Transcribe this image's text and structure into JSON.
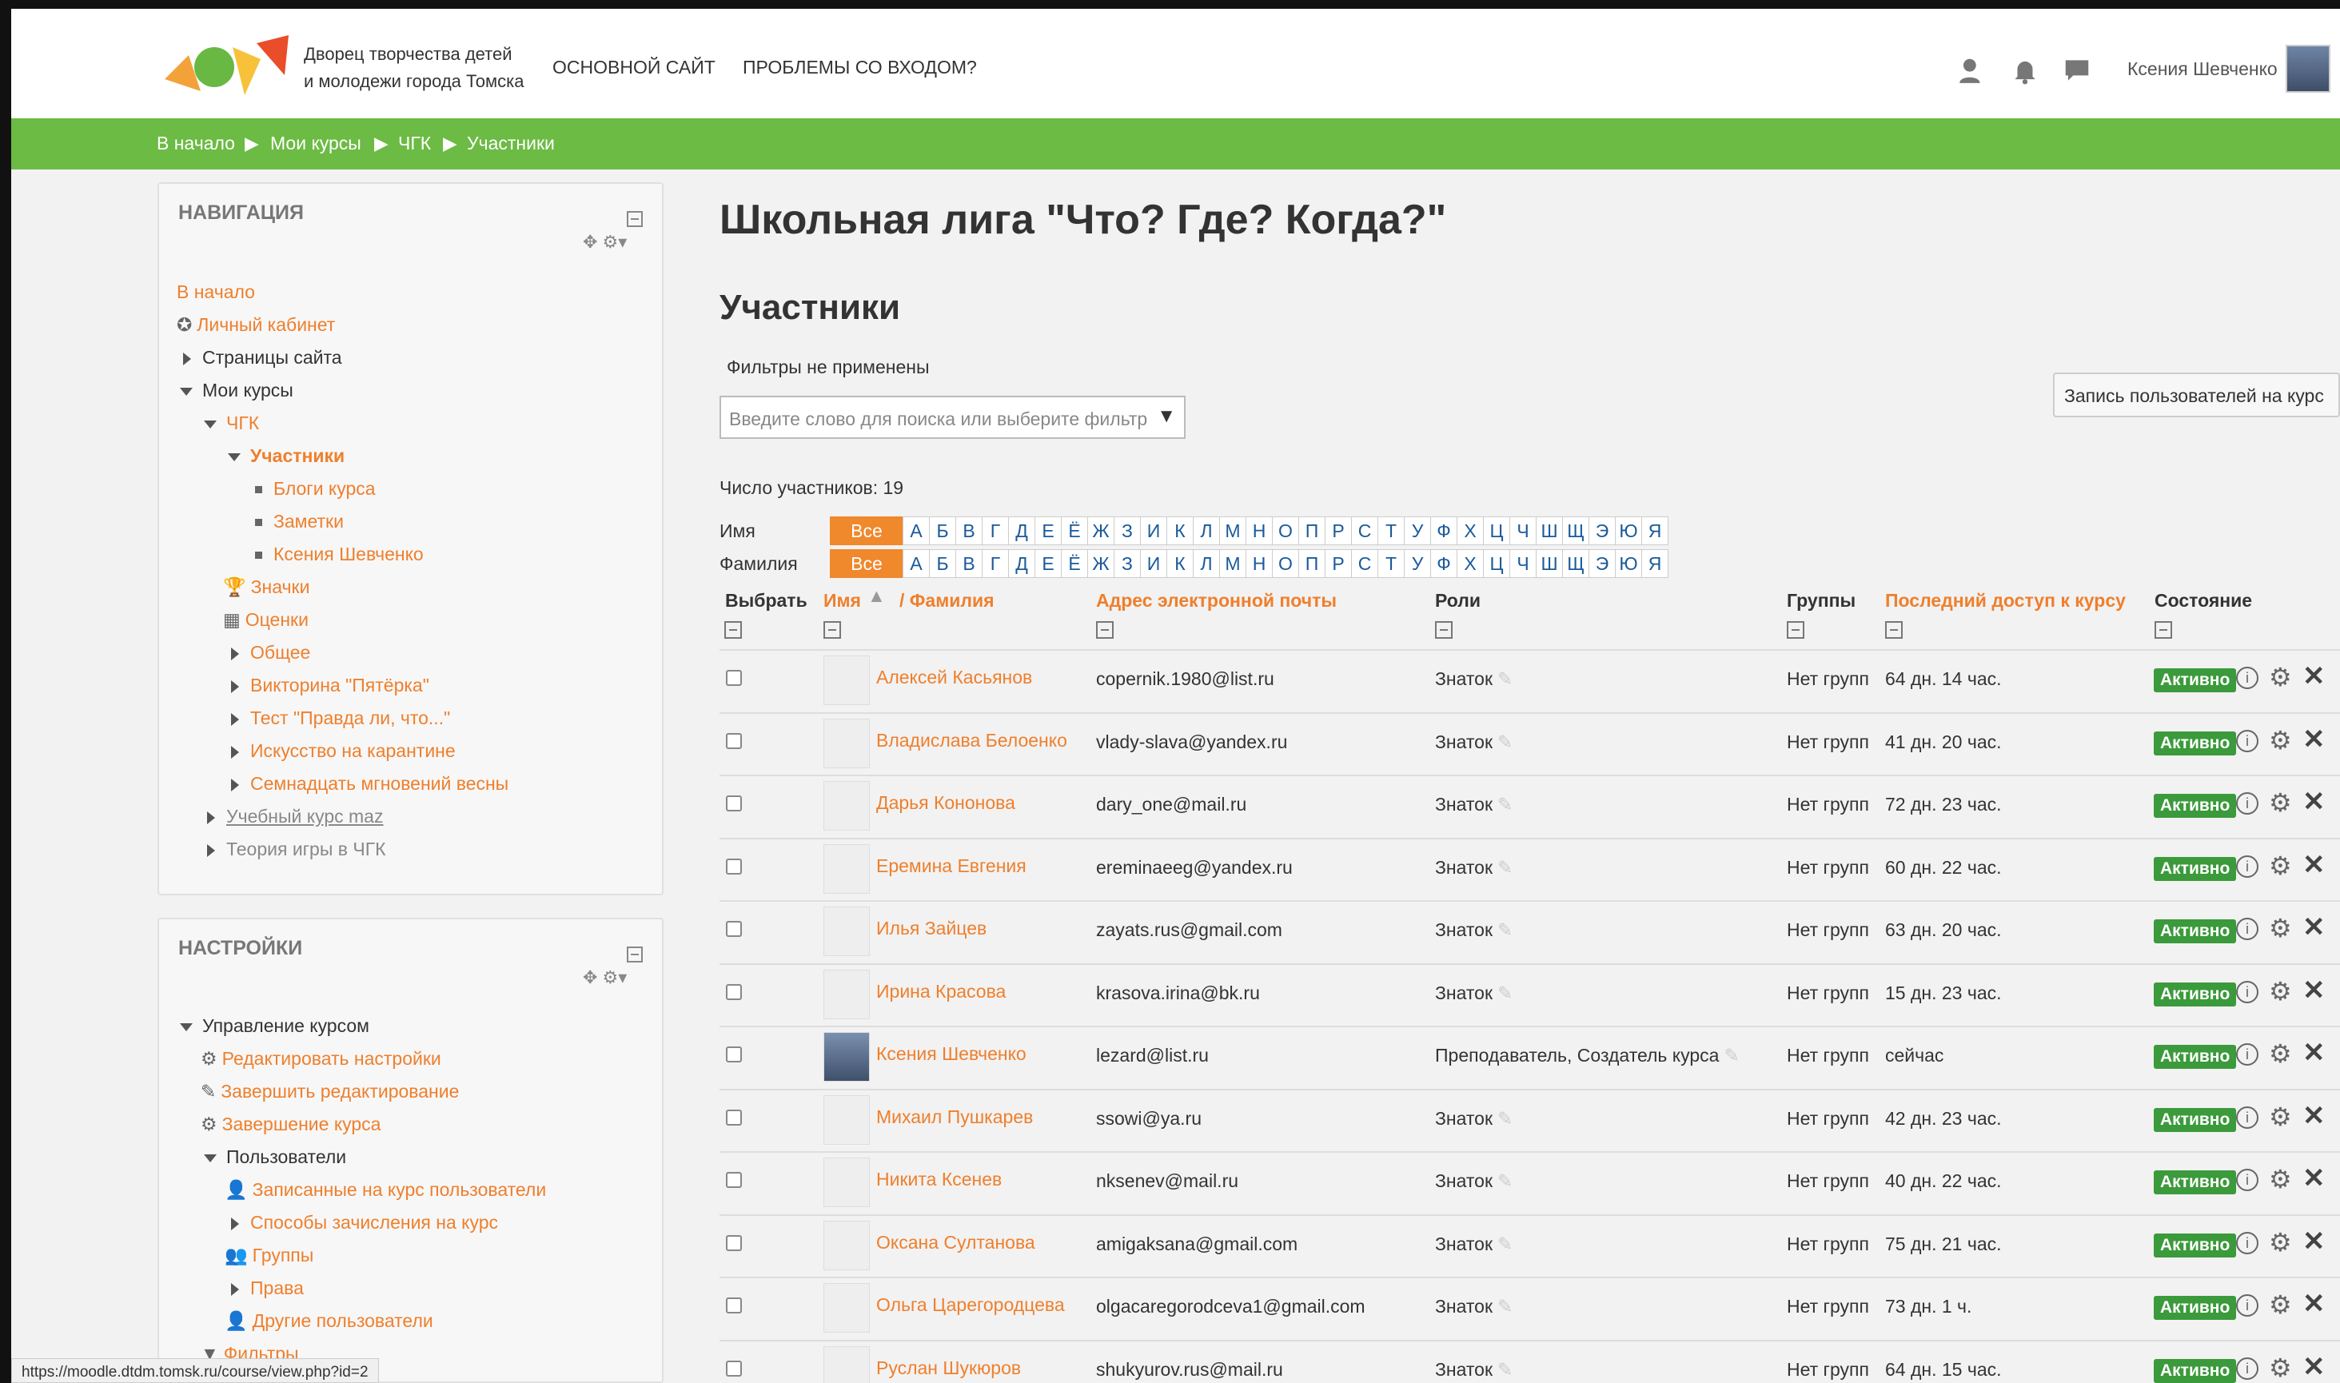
{
  "header": {
    "brand_line1": "Дворец творчества детей",
    "brand_line2": "и молодежи города Томска",
    "nav_main": "ОСНОВНОЙ САЙТ",
    "nav_login": "ПРОБЛЕМЫ СО ВХОДОМ?",
    "user_name": "Ксения Шевченко"
  },
  "breadcrumb": [
    "В начало",
    "Мои курсы",
    "ЧГК",
    "Участники"
  ],
  "navigation": {
    "title": "НАВИГАЦИЯ",
    "items": [
      "В начало",
      "Личный кабинет",
      "Страницы сайта",
      "Мои курсы",
      "ЧГК",
      "Участники",
      "Блоги курса",
      "Заметки",
      "Ксения Шевченко",
      "Значки",
      "Оценки",
      "Общее",
      "Викторина \"Пятёрка\"",
      "Тест \"Правда ли, что...\"",
      "Искусство на карантине",
      "Семнадцать мгновений весны",
      "Учебный курс maz",
      "Теория игры в ЧГК"
    ]
  },
  "settings": {
    "title": "НАСТРОЙКИ",
    "items": [
      "Управление курсом",
      "Редактировать настройки",
      "Завершить редактирование",
      "Завершение курса",
      "Пользователи",
      "Записанные на курс пользователи",
      "Способы зачисления на курс",
      "Группы",
      "Права",
      "Другие пользователи",
      "Фильтры"
    ]
  },
  "status_url": "https://moodle.dtdm.tomsk.ru/course/view.php?id=2",
  "main": {
    "course_title": "Школьная лига \"Что? Где? Когда?\"",
    "section_title": "Участники",
    "filters_label": "Фильтры не применены",
    "search_placeholder": "Введите слово для поиска или выберите фильтр",
    "enroll_button": "Запись пользователей на курс",
    "count_label": "Число участников: 19",
    "firstname_label": "Имя",
    "lastname_label": "Фамилия",
    "letters": [
      "Все",
      "А",
      "Б",
      "В",
      "Г",
      "Д",
      "Е",
      "Ё",
      "Ж",
      "З",
      "И",
      "К",
      "Л",
      "М",
      "Н",
      "О",
      "П",
      "Р",
      "С",
      "Т",
      "У",
      "Ф",
      "Х",
      "Ц",
      "Ч",
      "Ш",
      "Щ",
      "Э",
      "Ю",
      "Я"
    ]
  },
  "table": {
    "headers": {
      "select": "Выбрать",
      "first": "Имя",
      "last": "/ Фамилия",
      "email": "Адрес электронной почты",
      "roles": "Роли",
      "groups": "Группы",
      "access": "Последний доступ к курсу",
      "status": "Состояние"
    },
    "rows": [
      {
        "name": "Алексей Касьянов",
        "email": "copernik.1980@list.ru",
        "role": "Знаток",
        "group": "Нет групп",
        "access": "64 дн. 14 час.",
        "status": "Активно"
      },
      {
        "name": "Владислава Белоенко",
        "email": "vlady-slava@yandex.ru",
        "role": "Знаток",
        "group": "Нет групп",
        "access": "41 дн. 20 час.",
        "status": "Активно"
      },
      {
        "name": "Дарья Кононова",
        "email": "dary_one@mail.ru",
        "role": "Знаток",
        "group": "Нет групп",
        "access": "72 дн. 23 час.",
        "status": "Активно"
      },
      {
        "name": "Еремина Евгения",
        "email": "ereminaeeg@yandex.ru",
        "role": "Знаток",
        "group": "Нет групп",
        "access": "60 дн. 22 час.",
        "status": "Активно"
      },
      {
        "name": "Илья Зайцев",
        "email": "zayats.rus@gmail.com",
        "role": "Знаток",
        "group": "Нет групп",
        "access": "63 дн. 20 час.",
        "status": "Активно"
      },
      {
        "name": "Ирина Красова",
        "email": "krasova.irina@bk.ru",
        "role": "Знаток",
        "group": "Нет групп",
        "access": "15 дн. 23 час.",
        "status": "Активно"
      },
      {
        "name": "Ксения Шевченко",
        "email": "lezard@list.ru",
        "role": "Преподаватель, Создатель курса",
        "group": "Нет групп",
        "access": "сейчас",
        "status": "Активно"
      },
      {
        "name": "Михаил Пушкарев",
        "email": "ssowi@ya.ru",
        "role": "Знаток",
        "group": "Нет групп",
        "access": "42 дн. 23 час.",
        "status": "Активно"
      },
      {
        "name": "Никита Ксенев",
        "email": "nksenev@mail.ru",
        "role": "Знаток",
        "group": "Нет групп",
        "access": "40 дн. 22 час.",
        "status": "Активно"
      },
      {
        "name": "Оксана Султанова",
        "email": "amigaksana@gmail.com",
        "role": "Знаток",
        "group": "Нет групп",
        "access": "75 дн. 21 час.",
        "status": "Активно"
      },
      {
        "name": "Ольга Царегородцева",
        "email": "olgacaregorodceva1@gmail.com",
        "role": "Знаток",
        "group": "Нет групп",
        "access": "73 дн. 1 ч.",
        "status": "Активно"
      },
      {
        "name": "Руслан Шукюров",
        "email": "shukyurov.rus@mail.ru",
        "role": "Знаток",
        "group": "Нет групп",
        "access": "64 дн. 15 час.",
        "status": "Активно"
      }
    ]
  },
  "colors": {
    "accent": "#ef7f2c",
    "green_bar": "#6cbb44",
    "active": "#3b9a3b"
  }
}
